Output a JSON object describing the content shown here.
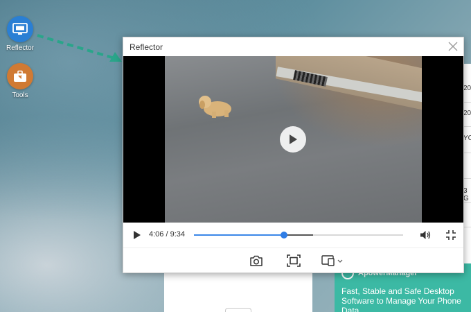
{
  "desktop": {
    "icons": [
      {
        "label": "Reflector",
        "icon": "monitor-icon",
        "color": "#2a7fd4"
      },
      {
        "label": "Tools",
        "icon": "toolbox-icon",
        "color": "#d07a33"
      }
    ]
  },
  "window": {
    "title": "Reflector",
    "close_icon": "close-icon"
  },
  "player": {
    "current_time": "4:06",
    "separator": " / ",
    "total_time": "9:34",
    "progress_fraction": 0.429,
    "buffered_fraction": 0.57,
    "accent_color": "#2f7de6"
  },
  "toolbar": {
    "screenshot_icon": "camera-icon",
    "fullscreen_icon": "fullscreen-icon",
    "cast_icon": "screen-cast-icon"
  },
  "ad": {
    "brand": "ApowerManager",
    "text": "Fast, Stable and Safe Desktop Software to Manage Your Phone Data",
    "color": "#3cb9a4"
  },
  "background_panel": {
    "fragments": [
      "20",
      "20",
      "YC",
      "3 G"
    ]
  }
}
